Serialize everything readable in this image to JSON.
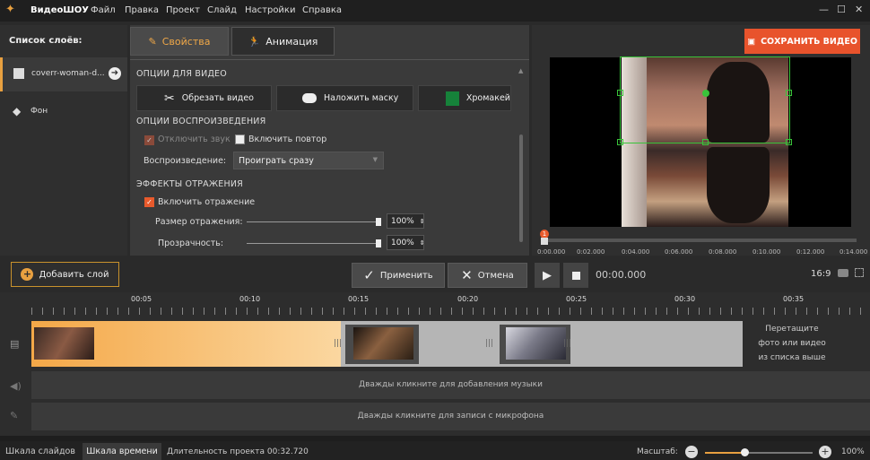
{
  "app": {
    "name": "ВидеоШОУ"
  },
  "menu": [
    "Файл",
    "Правка",
    "Проект",
    "Слайд",
    "Настройки",
    "Справка"
  ],
  "layers": {
    "title": "Список слоёв:",
    "items": [
      "coverr-woman-d...",
      "Фон"
    ]
  },
  "tabs": {
    "properties": "Свойства",
    "animation": "Анимация"
  },
  "video_options": {
    "title": "ОПЦИИ ДЛЯ ВИДЕО",
    "crop": "Обрезать видео",
    "mask": "Наложить маску",
    "chroma": "Хромакей"
  },
  "playback_options": {
    "title": "ОПЦИИ ВОСПРОИЗВЕДЕНИЯ",
    "mute": "Отключить звук",
    "loop": "Включить повтор",
    "playback_label": "Воспроизведение:",
    "playback_value": "Проиграть сразу"
  },
  "reflection": {
    "title": "ЭФФЕКТЫ ОТРАЖЕНИЯ",
    "enable": "Включить отражение",
    "size_label": "Размер отражения:",
    "size_value": "100%",
    "opacity_label": "Прозрачность:",
    "opacity_value": "100%"
  },
  "save": {
    "label": "СОХРАНИТЬ ВИДЕО"
  },
  "preview": {
    "ticks": [
      "0:00.000",
      "0:02.000",
      "0:04.000",
      "0:06.000",
      "0:08.000",
      "0:10.000",
      "0:12.000",
      "0:14.000"
    ],
    "marker": "1",
    "time": "00:00.000",
    "aspect": "16:9"
  },
  "actions": {
    "add_layer": "Добавить слой",
    "apply": "Применить",
    "cancel": "Отмена"
  },
  "timeline": {
    "ruler": [
      "00:05",
      "00:10",
      "00:15",
      "00:20",
      "00:25",
      "00:30",
      "00:35"
    ],
    "drop_hint": [
      "Перетащите",
      "фото или видео",
      "из списка выше"
    ],
    "music_hint": "Дважды кликните для добавления музыки",
    "mic_hint": "Дважды кликните для записи с микрофона"
  },
  "status": {
    "tab_slides": "Шкала слайдов",
    "tab_timeline": "Шкала времени",
    "duration": "Длительность проекта 00:32.720",
    "scale_label": "Масштаб:",
    "zoom": "100%"
  },
  "colors": {
    "accent": "#e8a040",
    "save": "#e8532c",
    "selection": "#39c43a"
  }
}
